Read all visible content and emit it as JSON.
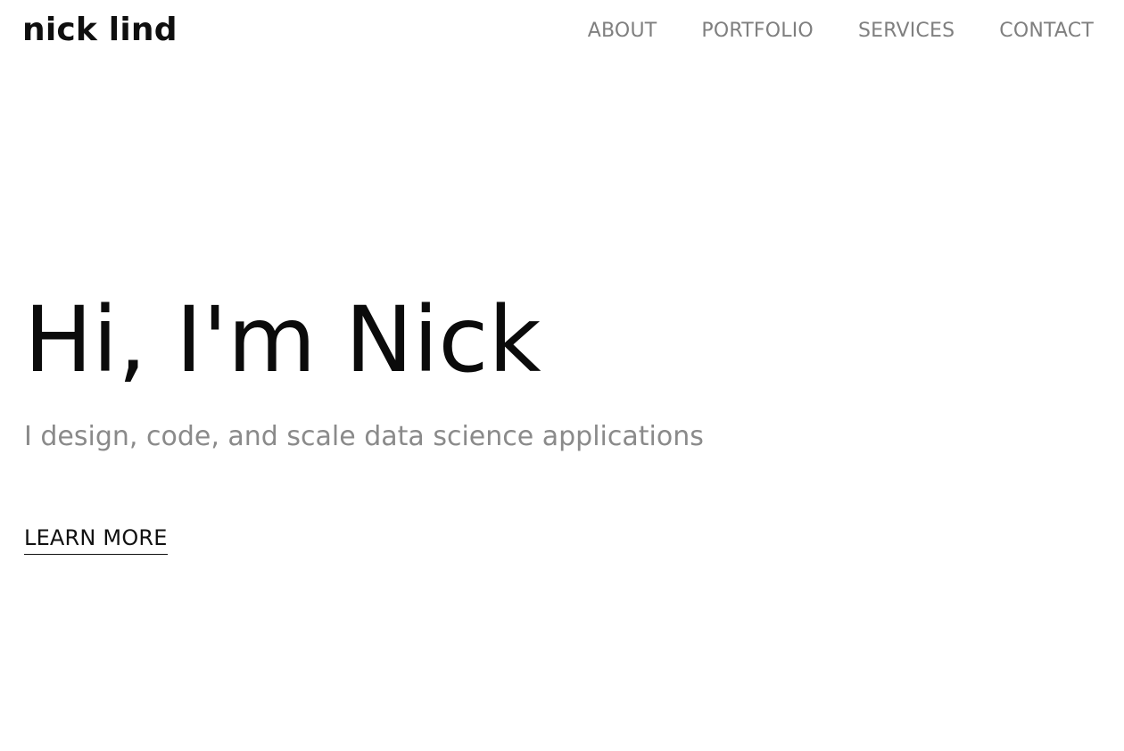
{
  "header": {
    "logo_text": "nick lind",
    "nav": [
      {
        "label": "ABOUT"
      },
      {
        "label": "PORTFOLIO"
      },
      {
        "label": "SERVICES"
      },
      {
        "label": "CONTACT"
      }
    ]
  },
  "hero": {
    "title": "Hi, I'm Nick",
    "subtitle": "I design, code, and scale data science applications",
    "cta_label": "LEARN MORE"
  },
  "colors": {
    "background": "#ffffff",
    "primary_text": "#0b0b0b",
    "muted_text": "#8a8a8a",
    "nav_text": "#7f7f7f"
  }
}
